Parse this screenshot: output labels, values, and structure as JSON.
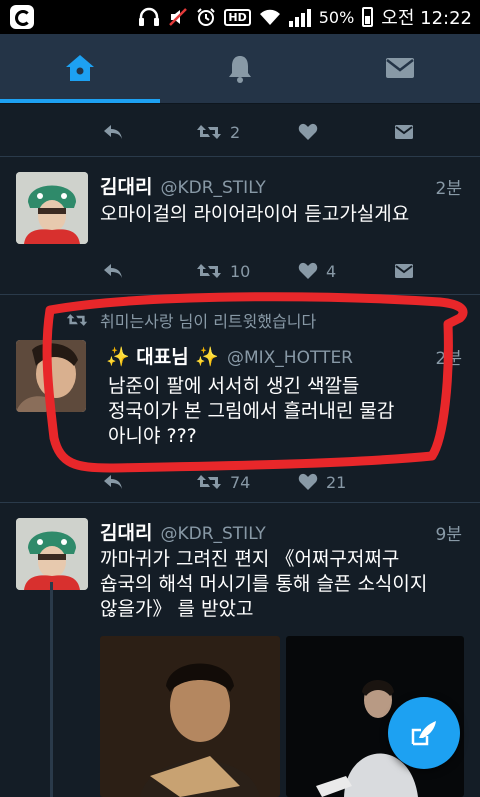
{
  "status_bar": {
    "battery_percent": "50%",
    "clock": "오전 12:22",
    "hd_label": "HD"
  },
  "tabs": [
    {
      "icon": "home-icon",
      "active": true
    },
    {
      "icon": "notifications-bell-icon",
      "active": false
    },
    {
      "icon": "messages-envelope-icon",
      "active": false
    }
  ],
  "tweets": [
    {
      "partial": true,
      "retweet_count": "2",
      "like_count": ""
    },
    {
      "name": "김대리",
      "handle": "@KDR_STILY",
      "time": "2분",
      "text": "오마이걸의 라이어라이어 듣고가실게요",
      "retweet_count": "10",
      "like_count": "4"
    },
    {
      "retweeted_by": "취미는사랑 님이 리트윗했습니다",
      "name": "✨ 대표님 ✨",
      "handle": "@MIX_HOTTER",
      "time": "2분",
      "text_lines": [
        "남준이 팔에 서서히 생긴 색깔들",
        "정국이가 본 그림에서 흘러내린 물감",
        "아니야 ???"
      ],
      "retweet_count": "74",
      "like_count": "21"
    },
    {
      "name": "김대리",
      "handle": "@KDR_STILY",
      "time": "9분",
      "text_lines": [
        "까마귀가 그려진 편지 《어쩌구저쩌구",
        "숍국의 해석 머시기를 통해 슬픈 소식이지",
        "않을가》 를 받았고"
      ]
    }
  ],
  "colors": {
    "background": "#141d26",
    "tabbar": "#243447",
    "accent": "#1da1f2",
    "secondary_text": "#8899a6",
    "highlight_marker": "#e8272a"
  },
  "fab": {
    "icon": "compose-tweet-icon"
  }
}
